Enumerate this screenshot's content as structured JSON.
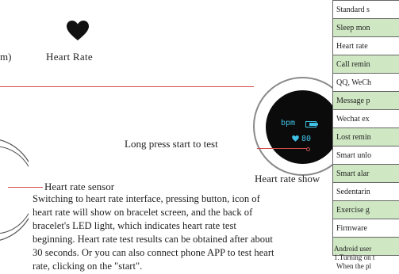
{
  "left_labels": {
    "m_fragment": "m)",
    "heart_rate_title": "Heart Rate"
  },
  "device": {
    "bpm_label": "bpm",
    "hr_value": "80"
  },
  "captions": {
    "long_press": "Long press start to test",
    "hr_sensor": "Heart rate sensor",
    "hr_show": "Heart rate show"
  },
  "description": "Switching to heart rate interface, pressing button, icon of heart rate will show on bracelet screen, and the back of bracelet's LED light, which indicates heart rate test beginning. Heart rate test results can be obtained after about 30 seconds. Or you can also connect phone APP to test heart rate, clicking on the \"start\".",
  "feature_table": [
    {
      "label": "Standard s",
      "shade": "white"
    },
    {
      "label": "Sleep mon",
      "shade": "green"
    },
    {
      "label": "Heart rate",
      "shade": "white"
    },
    {
      "label": "Call remin",
      "shade": "green"
    },
    {
      "label": "QQ, WeCh",
      "shade": "white"
    },
    {
      "label": "Message p",
      "shade": "green"
    },
    {
      "label": "Wechat ex",
      "shade": "white"
    },
    {
      "label": "Lost remin",
      "shade": "green"
    },
    {
      "label": "Smart unlo",
      "shade": "white"
    },
    {
      "label": "Smart alar",
      "shade": "green"
    },
    {
      "label": "Sedentarin",
      "shade": "white"
    },
    {
      "label": "Exercise g",
      "shade": "green"
    },
    {
      "label": "Firmware",
      "shade": "white"
    },
    {
      "label": "",
      "shade": "green"
    }
  ],
  "android_note": {
    "line1": "Android user",
    "line2": "1.Turning on t",
    "line3": "When the pl"
  },
  "colors": {
    "accent_red": "#d44a4a",
    "screen_cyan": "#3fc2e6",
    "table_green": "#cfe8c3"
  }
}
